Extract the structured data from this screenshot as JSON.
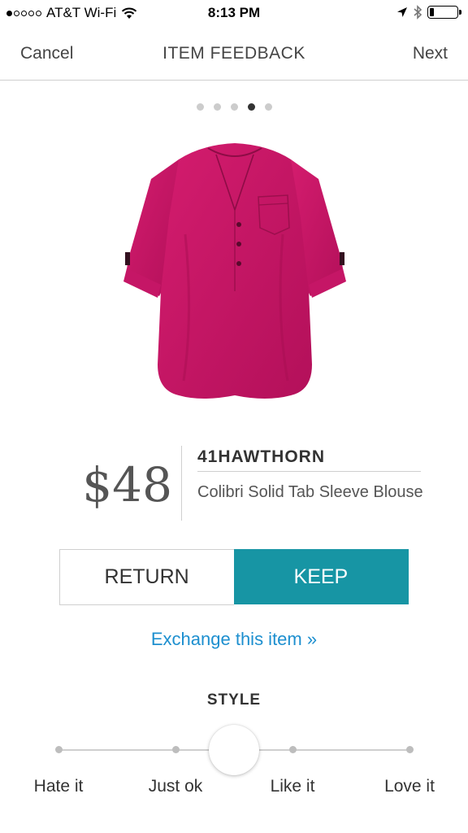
{
  "status_bar": {
    "carrier": "AT&T Wi-Fi",
    "time": "8:13 PM",
    "signal_bars_filled": 1,
    "signal_bars_total": 5
  },
  "nav": {
    "cancel": "Cancel",
    "title": "ITEM FEEDBACK",
    "next": "Next"
  },
  "pager": {
    "count": 5,
    "active_index": 3
  },
  "product": {
    "price": "$48",
    "brand": "41HAWTHORN",
    "name": "Colibri Solid Tab Sleeve Blouse",
    "color": "#c0145f"
  },
  "decision": {
    "return_label": "RETURN",
    "keep_label": "KEEP",
    "selected": "KEEP",
    "accent": "#1795a4"
  },
  "exchange_link": "Exchange this item »",
  "style_rating": {
    "heading": "STYLE",
    "labels": [
      "Hate it",
      "Just ok",
      "Like it",
      "Love it"
    ],
    "value_fraction": 0.5
  },
  "icons": [
    "wifi-icon",
    "location-arrow-icon",
    "bluetooth-icon",
    "battery-icon"
  ]
}
